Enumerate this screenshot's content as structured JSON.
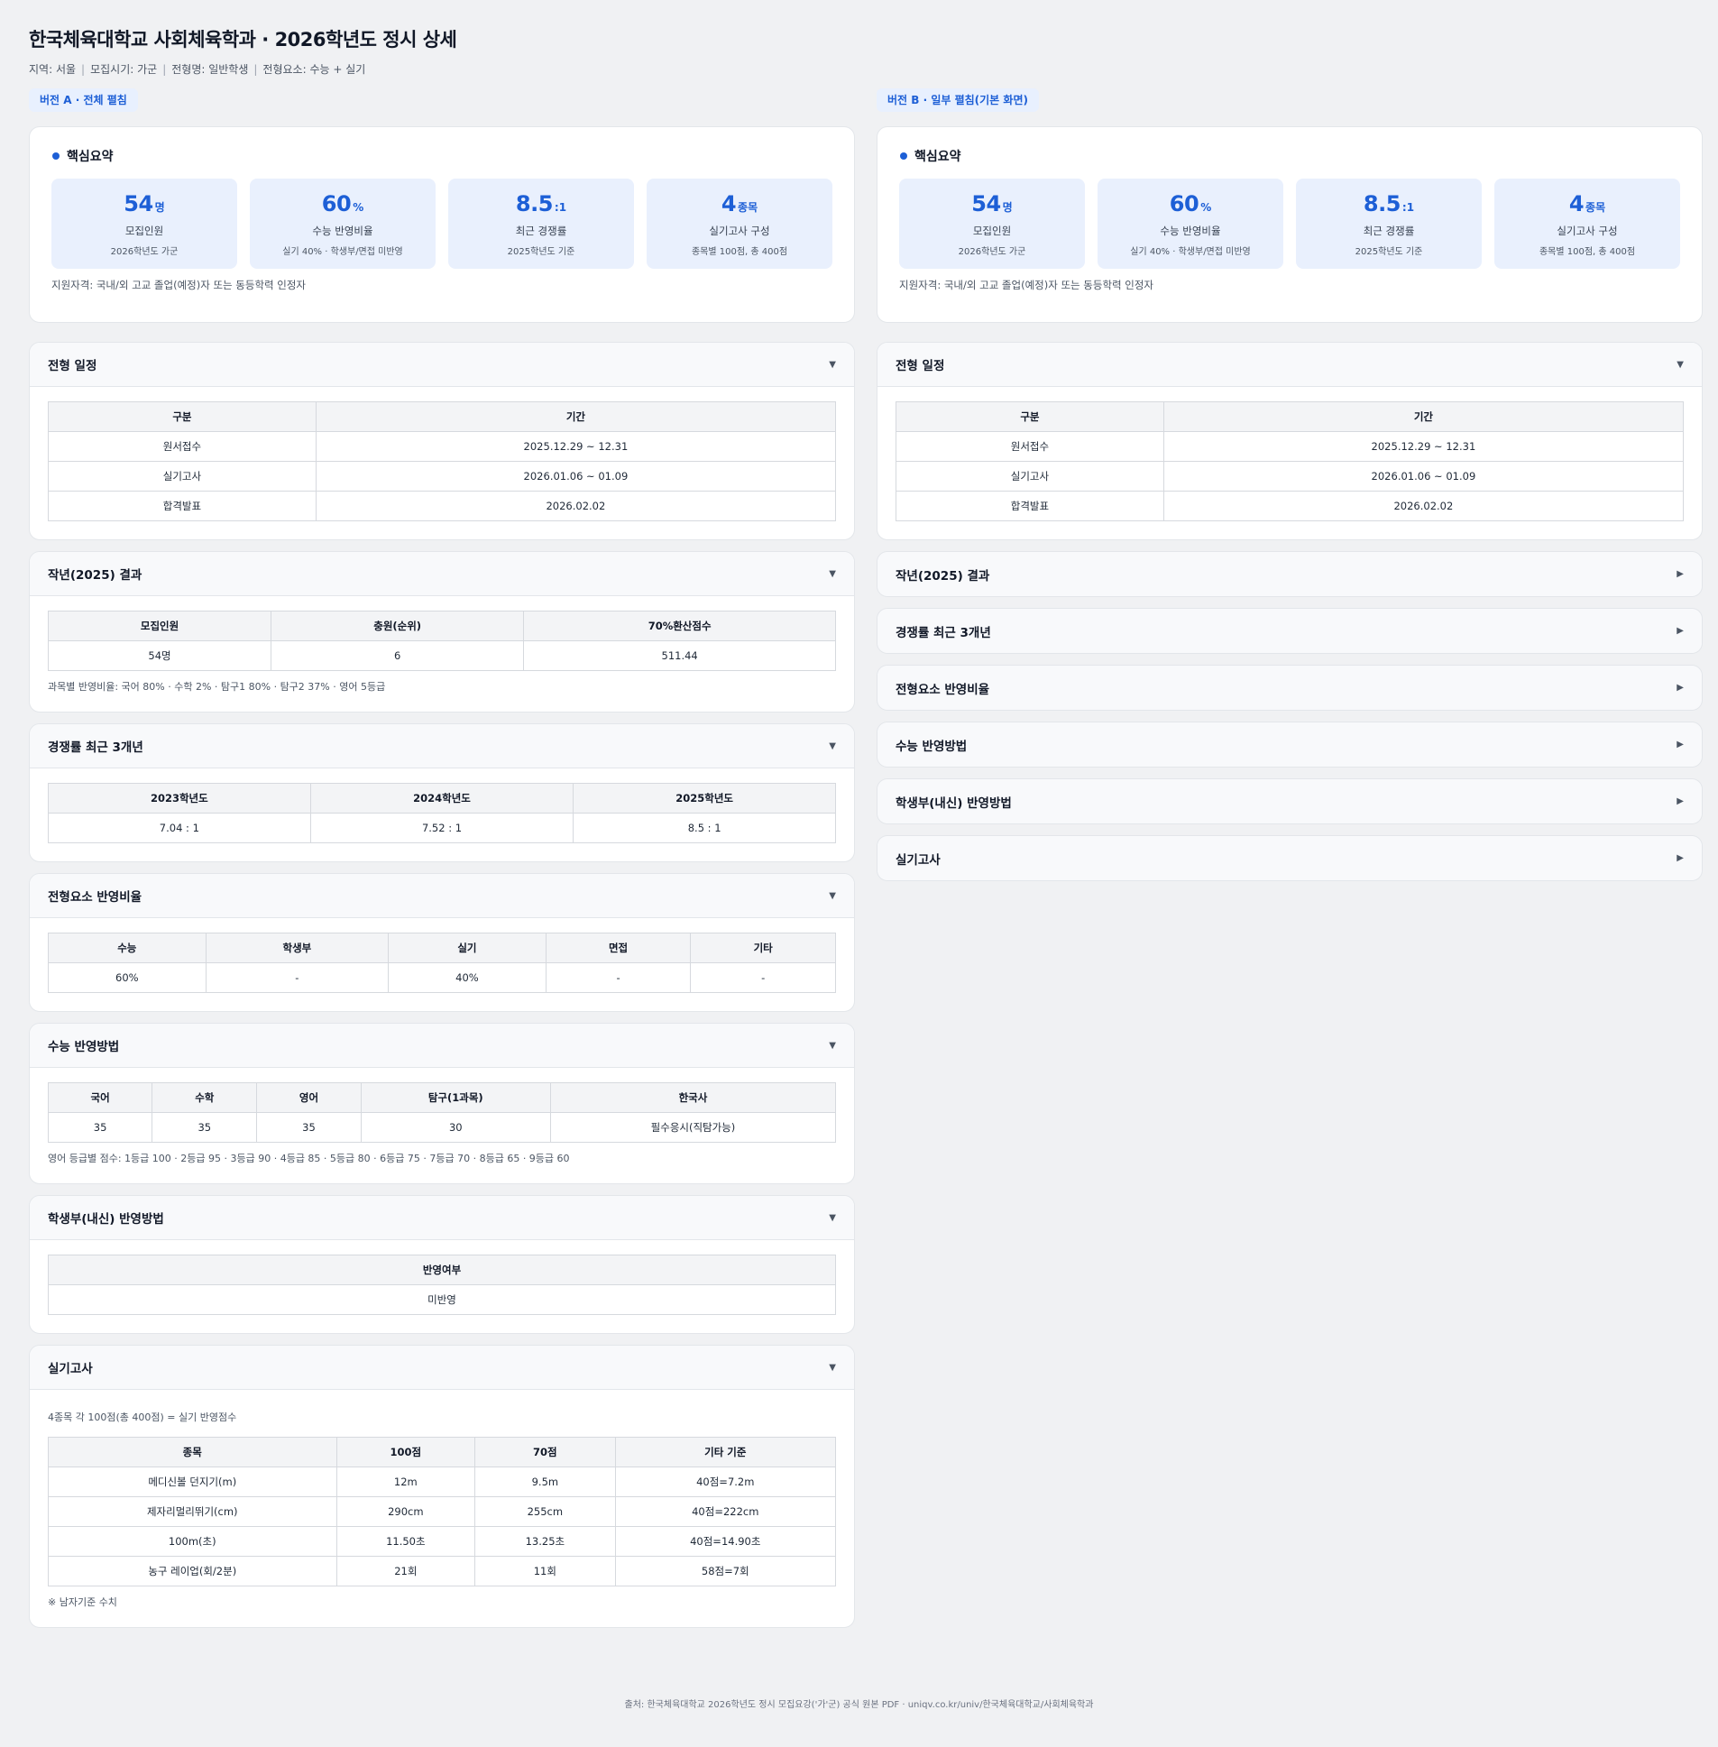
{
  "title": "한국체육대학교 사회체육학과 · 2026학년도 정시 상세",
  "meta": {
    "region": "지역: 서울",
    "period": "모집시기: 가군",
    "type": "전형명: 일반학생",
    "elements": "전형요소: 수능 + 실기"
  },
  "summary": {
    "heading": "핵심요약",
    "stats": [
      {
        "num": "54",
        "unit": "명",
        "label": "모집인원",
        "sub": "2026학년도 가군"
      },
      {
        "num": "60",
        "unit": "%",
        "label": "수능 반영비율",
        "sub": "실기 40% · 학생부/면접 미반영"
      },
      {
        "num": "8.5",
        "unit": ":1",
        "label": "최근 경쟁률",
        "sub": "2025학년도 기준"
      },
      {
        "num": "4",
        "unit": "종목",
        "label": "실기고사 구성",
        "sub": "종목별 100점, 총 400점"
      }
    ],
    "note": "지원자격: 국내/외 고교 졸업(예정)자 또는 동등학력 인정자"
  },
  "versions": {
    "a": "버전 A · 전체 펼침",
    "b": "버전 B · 일부 펼침(기본 화면)"
  },
  "sections": {
    "schedule": {
      "title": "전형 일정",
      "headers": [
        "구분",
        "기간"
      ],
      "rows": [
        [
          "원서접수",
          "2025.12.29 ~ 12.31"
        ],
        [
          "실기고사",
          "2026.01.06 ~ 01.09"
        ],
        [
          "합격발표",
          "2026.02.02"
        ]
      ]
    },
    "result": {
      "title": "작년(2025) 결과",
      "headers": [
        "모집인원",
        "충원(순위)",
        "70%환산점수"
      ],
      "rows": [
        [
          "54명",
          "6",
          "511.44"
        ]
      ],
      "note": "과목별 반영비율: 국어 80% · 수학 2% · 탐구1 80% · 탐구2 37% · 영어 5등급"
    },
    "competition": {
      "title": "경쟁률 최근 3개년",
      "headers": [
        "2023학년도",
        "2024학년도",
        "2025학년도"
      ],
      "rows": [
        [
          "7.04 : 1",
          "7.52 : 1",
          "8.5 : 1"
        ]
      ]
    },
    "ratio": {
      "title": "전형요소 반영비율",
      "headers": [
        "수능",
        "학생부",
        "실기",
        "면접",
        "기타"
      ],
      "rows": [
        [
          "60%",
          "-",
          "40%",
          "-",
          "-"
        ]
      ]
    },
    "suneung": {
      "title": "수능 반영방법",
      "headers": [
        "국어",
        "수학",
        "영어",
        "탐구(1과목)",
        "한국사"
      ],
      "rows": [
        [
          "35",
          "35",
          "35",
          "30",
          "필수응시(직탐가능)"
        ]
      ],
      "note": "영어 등급별 점수: 1등급 100 · 2등급 95 · 3등급 90 · 4등급 85 · 5등급 80 · 6등급 75 · 7등급 70 · 8등급 65 · 9등급 60"
    },
    "record": {
      "title": "학생부(내신) 반영방법",
      "headers": [
        "반영여부"
      ],
      "rows": [
        [
          "미반영"
        ]
      ]
    },
    "practical": {
      "title": "실기고사",
      "pre_note": "4종목 각 100점(총 400점) = 실기 반영점수",
      "headers": [
        "종목",
        "100점",
        "70점",
        "기타 기준"
      ],
      "rows": [
        [
          "메디신볼 던지기(m)",
          "12m",
          "9.5m",
          "40점=7.2m"
        ],
        [
          "제자리멀리뛰기(cm)",
          "290cm",
          "255cm",
          "40점=222cm"
        ],
        [
          "100m(초)",
          "11.50초",
          "13.25초",
          "40점=14.90초"
        ],
        [
          "농구 레이업(회/2분)",
          "21회",
          "11회",
          "58점=7회"
        ]
      ],
      "note": "※ 남자기준 수치"
    }
  },
  "icons": {
    "expanded": "caret-down-icon",
    "collapsed": "caret-right-icon"
  },
  "colors": {
    "accent": "#1d5fd6",
    "stat_bg": "#e9f0fd",
    "page_bg": "#f0f1f3"
  },
  "footer": "출처: 한국체육대학교 2026학년도 정시 모집요강('가'군) 공식 원본 PDF · uniqv.co.kr/univ/한국체육대학교/사회체육학과"
}
